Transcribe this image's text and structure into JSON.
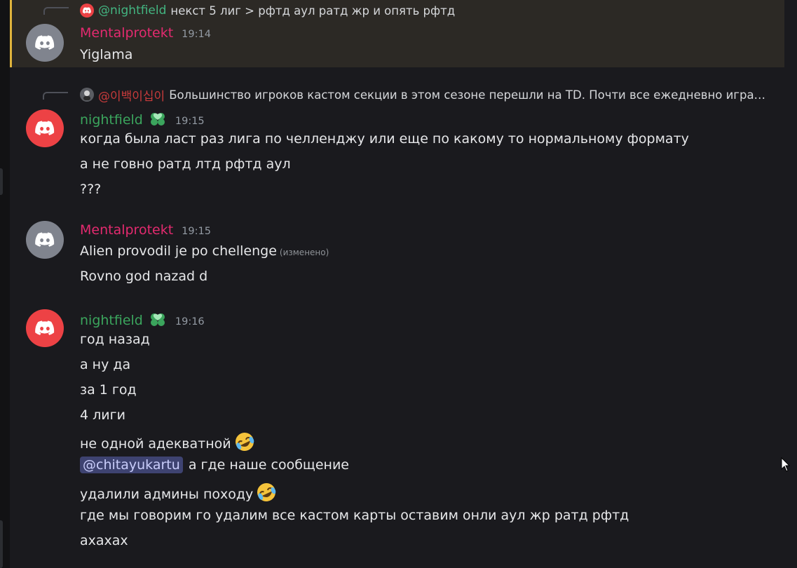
{
  "messages": [
    {
      "reply": {
        "name": "@nightfield",
        "text": "некст 5 лиг > рфтд аул ратд жр и опять рфтд"
      },
      "author": "Mentalprotekt",
      "time": "19:14",
      "lines": [
        "Yiglama"
      ]
    },
    {
      "reply": {
        "name": "@이백이십이",
        "text": "Большинство игроков кастом секции в этом сезоне перешли на TD.  Почти все ежедневно игра…"
      },
      "author": "nightfield",
      "time": "19:15",
      "lines": [
        "когда была ласт раз лига по челленджу или еще по какому то нормальному формату",
        "а не говно ратд лтд рфтд аул",
        "???"
      ]
    },
    {
      "author": "Mentalprotekt",
      "time": "19:15",
      "lines": [
        "Alien provodil je po chellenge",
        "Rovno god nazad d"
      ],
      "edited": "(изменено)"
    },
    {
      "author": "nightfield",
      "time": "19:16",
      "lines": [
        "год назад",
        "а ну да",
        "за 1 год",
        "4 лиги",
        "не одной адекватной",
        "а где наше сообщение",
        "удалили админы походу",
        "где мы говорим го удалим все кастом карты оставим онли аул жр ратд рфтд",
        "ахахах"
      ],
      "mention": "@chitayukartu"
    }
  ],
  "colors": {
    "background": "#1a1a1e",
    "highlight": "#2c2925",
    "highlight_bar": "#e0b43c",
    "mentalprotekt": "#e32a6f",
    "nightfield": "#3ba55d"
  },
  "icons": [
    "discord-logo-icon",
    "clover-heart-badge-icon",
    "rofl-emoji-icon",
    "mouse-cursor-icon"
  ]
}
